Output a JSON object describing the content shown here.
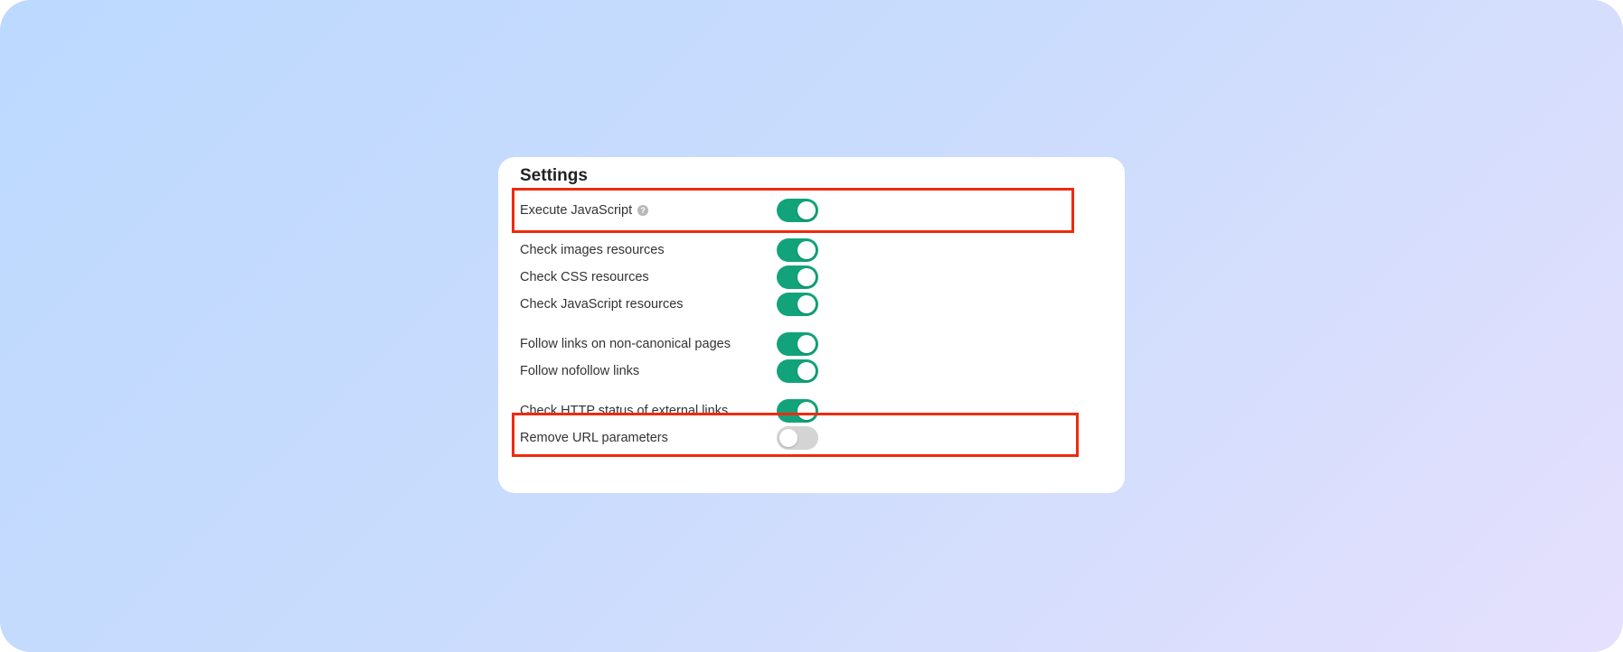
{
  "settings": {
    "title": "Settings",
    "colors": {
      "toggle_on": "#12a37a",
      "toggle_off": "#d4d4d4",
      "highlight": "#ef2a0e"
    },
    "items": [
      {
        "label": "Execute JavaScript",
        "enabled": true,
        "help_icon": "question-circle-icon",
        "highlighted": true
      },
      {
        "label": "Check images resources",
        "enabled": true
      },
      {
        "label": "Check CSS resources",
        "enabled": true
      },
      {
        "label": "Check JavaScript resources",
        "enabled": true
      },
      {
        "label": "Follow links on non-canonical pages",
        "enabled": true
      },
      {
        "label": "Follow nofollow links",
        "enabled": true
      },
      {
        "label": "Check HTTP status of external links",
        "enabled": true,
        "highlighted": true
      },
      {
        "label": "Remove URL parameters",
        "enabled": false
      }
    ]
  }
}
